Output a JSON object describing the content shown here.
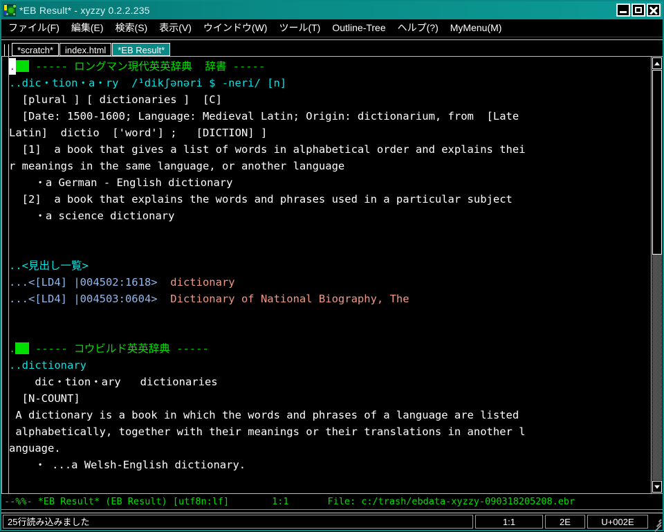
{
  "window": {
    "title": "*EB Result* - xyzzy 0.2.2.235",
    "icon": "turtle-icon",
    "controls": {
      "minimize": "minimize-icon",
      "maximize": "maximize-icon",
      "close": "close-icon"
    },
    "title_bar_color": "#0a8a86"
  },
  "menubar": {
    "items": [
      {
        "label": "ファイル(F)",
        "mnemonic": "F"
      },
      {
        "label": "編集(E)",
        "mnemonic": "E"
      },
      {
        "label": "検索(S)",
        "mnemonic": "S"
      },
      {
        "label": "表示(V)",
        "mnemonic": "V"
      },
      {
        "label": "ウインドウ(W)",
        "mnemonic": "W"
      },
      {
        "label": "ツール(T)",
        "mnemonic": "T"
      },
      {
        "label": "Outline-Tree",
        "mnemonic": "O"
      },
      {
        "label": "ヘルプ(?)",
        "mnemonic": "?"
      },
      {
        "label": "MyMenu(M)",
        "mnemonic": "M"
      }
    ]
  },
  "tabs": {
    "items": [
      {
        "label": "*scratch*",
        "active": false
      },
      {
        "label": "index.html",
        "active": false
      },
      {
        "label": "*EB Result*",
        "active": true
      }
    ]
  },
  "editor": {
    "colors": {
      "background": "#000000",
      "heading": "#00e000",
      "headword": "#00e5e5",
      "body": "#ffffff",
      "reference": "#93b7e8",
      "entry_title": "#f09a84",
      "cursor": "#ffffff"
    },
    "lines": [
      {
        "id": "l01",
        "segments": [
          {
            "text": ".",
            "style": "cursor"
          },
          {
            "text": "",
            "style": "greenblock"
          },
          {
            "text": " ----- ロングマン現代英英辞典  辞書 -----",
            "style": "green"
          }
        ]
      },
      {
        "id": "l02",
        "segments": [
          {
            "text": "..dic・tion・a・ry  /¹dikʃənəri $ -neri/ [n]",
            "style": "cyan"
          }
        ]
      },
      {
        "id": "l03",
        "segments": [
          {
            "text": "  [plural ] [ dictionaries ]  [C]",
            "style": "white"
          }
        ]
      },
      {
        "id": "l04",
        "segments": [
          {
            "text": "  [Date: 1500-1600; Language: Medieval Latin; Origin: dictionarium, from  [Late",
            "style": "white"
          }
        ]
      },
      {
        "id": "l05",
        "segments": [
          {
            "text": "Latin]  dictio  ['word'] ;   [DICTION] ]",
            "style": "white"
          }
        ]
      },
      {
        "id": "l06",
        "segments": [
          {
            "text": "  [1]  a book that gives a list of words in alphabetical order and explains thei",
            "style": "white"
          }
        ]
      },
      {
        "id": "l07",
        "segments": [
          {
            "text": "r meanings in the same language, or another language",
            "style": "white"
          }
        ]
      },
      {
        "id": "l08",
        "segments": [
          {
            "text": "    ・a German - English dictionary",
            "style": "white"
          }
        ]
      },
      {
        "id": "l09",
        "segments": [
          {
            "text": "  [2]  a book that explains the words and phrases used in a particular subject",
            "style": "white"
          }
        ]
      },
      {
        "id": "l10",
        "segments": [
          {
            "text": "    ・a science dictionary",
            "style": "white"
          }
        ]
      },
      {
        "id": "l11",
        "segments": [
          {
            "text": "",
            "style": "white"
          }
        ]
      },
      {
        "id": "l12",
        "segments": [
          {
            "text": "",
            "style": "white"
          }
        ]
      },
      {
        "id": "l13",
        "segments": [
          {
            "text": "..<見出し一覧>",
            "style": "cyan"
          }
        ]
      },
      {
        "id": "l14",
        "segments": [
          {
            "text": "...<[LD4] |004502:1618>  ",
            "style": "blue"
          },
          {
            "text": "dictionary",
            "style": "salmon"
          }
        ]
      },
      {
        "id": "l15",
        "segments": [
          {
            "text": "...<[LD4] |004503:0604>  ",
            "style": "blue"
          },
          {
            "text": "Dictionary of National Biography, The",
            "style": "salmon"
          }
        ]
      },
      {
        "id": "l16",
        "segments": [
          {
            "text": "",
            "style": "white"
          }
        ]
      },
      {
        "id": "l17",
        "segments": [
          {
            "text": "",
            "style": "white"
          }
        ]
      },
      {
        "id": "l18",
        "segments": [
          {
            "text": ".",
            "style": "green"
          },
          {
            "text": "",
            "style": "greenblock"
          },
          {
            "text": " ----- コウビルド英英辞典 -----",
            "style": "green"
          }
        ]
      },
      {
        "id": "l19",
        "segments": [
          {
            "text": "..dictionary",
            "style": "cyan"
          }
        ]
      },
      {
        "id": "l20",
        "segments": [
          {
            "text": "    dic・tion・ary   dictionaries",
            "style": "white"
          }
        ]
      },
      {
        "id": "l21",
        "segments": [
          {
            "text": "  [N-COUNT]",
            "style": "white"
          }
        ]
      },
      {
        "id": "l22",
        "segments": [
          {
            "text": " A dictionary is a book in which the words and phrases of a language are listed",
            "style": "white"
          }
        ]
      },
      {
        "id": "l23",
        "segments": [
          {
            "text": " alphabetically, together with their meanings or their translations in another l",
            "style": "white"
          }
        ]
      },
      {
        "id": "l24",
        "segments": [
          {
            "text": "anguage.",
            "style": "white"
          }
        ]
      },
      {
        "id": "l25",
        "segments": [
          {
            "text": "    ・ ...a Welsh-English dictionary.",
            "style": "white"
          }
        ]
      }
    ]
  },
  "scrollbar": {
    "up_arrow": "scroll-up-icon",
    "down_arrow": "scroll-down-icon",
    "thumb_position_percent": 0,
    "thumb_size_percent": 45
  },
  "modeline": {
    "left": "--%%- *EB Result* (EB Result) [utf8n:lf]",
    "position": "1:1",
    "file": "File: c:/trash/ebdata-xyzzy-090318205208.ebr"
  },
  "statusbar": {
    "message": "25行読み込みました",
    "position": "1:1",
    "hex": "2E",
    "codepoint": "U+002E",
    "grip": "resize-grip-icon"
  }
}
